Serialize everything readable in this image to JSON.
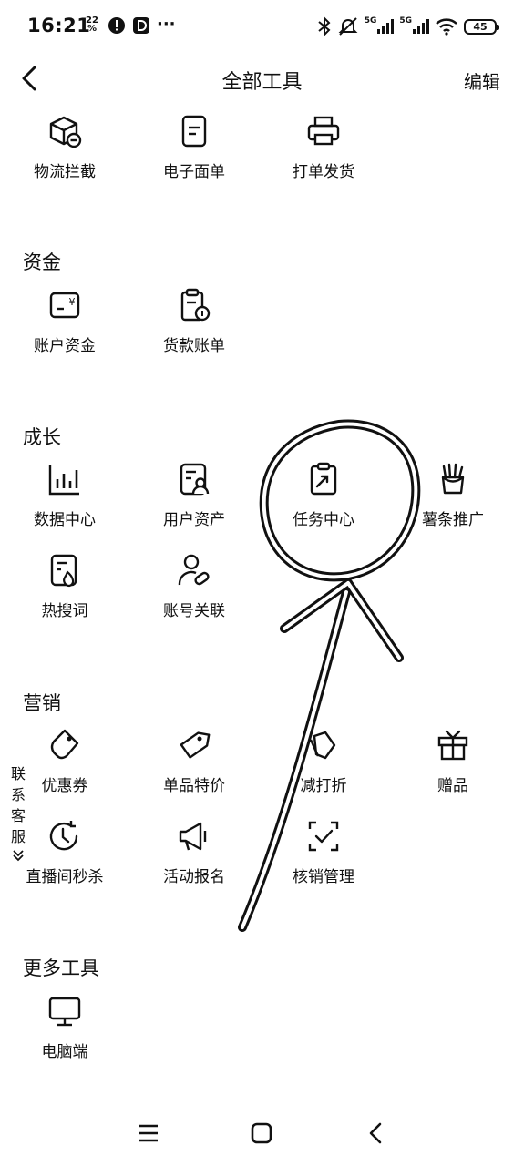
{
  "status_bar": {
    "time": "16:21",
    "small_indicator": "22\n%",
    "network_1": "5G",
    "network_2": "5G",
    "battery": "45",
    "overflow": "···"
  },
  "header": {
    "title": "全部工具",
    "edit_label": "编辑"
  },
  "sections": {
    "logistics": {
      "items": [
        {
          "label": "物流拦截",
          "icon": "package-icon"
        },
        {
          "label": "电子面单",
          "icon": "document-icon"
        },
        {
          "label": "打单发货",
          "icon": "printer-icon"
        }
      ]
    },
    "funds": {
      "title": "资金",
      "items": [
        {
          "label": "账户资金",
          "icon": "wallet-icon"
        },
        {
          "label": "货款账单",
          "icon": "bill-icon"
        }
      ]
    },
    "growth": {
      "title": "成长",
      "items": [
        {
          "label": "数据中心",
          "icon": "bar-chart-icon"
        },
        {
          "label": "用户资产",
          "icon": "user-asset-icon"
        },
        {
          "label": "任务中心",
          "icon": "task-trend-icon"
        },
        {
          "label": "薯条推广",
          "icon": "fries-icon"
        },
        {
          "label": "热搜词",
          "icon": "hot-search-icon"
        },
        {
          "label": "账号关联",
          "icon": "account-link-icon"
        }
      ]
    },
    "marketing": {
      "title": "营销",
      "items": [
        {
          "label": "优惠券",
          "icon": "coupon-icon"
        },
        {
          "label": "单品特价",
          "icon": "price-tag-icon"
        },
        {
          "label": "减打折",
          "icon": "discount-tag-icon"
        },
        {
          "label": "赠品",
          "icon": "gift-icon"
        },
        {
          "label": "直播间秒杀",
          "icon": "timer-icon"
        },
        {
          "label": "活动报名",
          "icon": "megaphone-icon"
        },
        {
          "label": "核销管理",
          "icon": "verify-icon"
        }
      ]
    },
    "more": {
      "title": "更多工具",
      "items": [
        {
          "label": "电脑端",
          "icon": "monitor-icon"
        }
      ]
    }
  },
  "side_contact": {
    "chars": [
      "联",
      "系",
      "客",
      "服"
    ]
  }
}
